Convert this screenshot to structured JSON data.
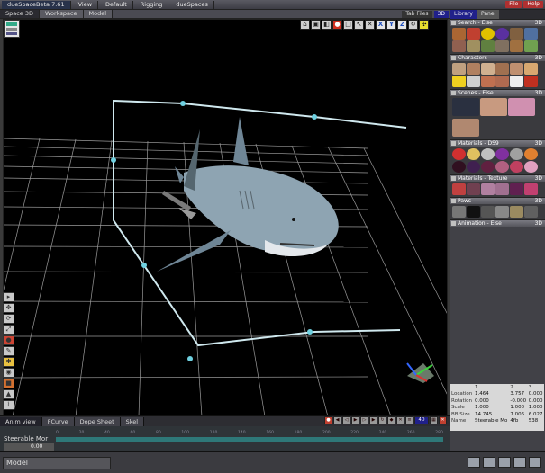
{
  "top_tabs": [
    "dueSpaceBeta 7.61",
    "View",
    "Default",
    "Rigging",
    "dueSpaces"
  ],
  "top_buttons": [
    "File",
    "Help"
  ],
  "sub_tabs": [
    "Space 3D",
    "Workspace",
    "Model"
  ],
  "view_labels": {
    "tab_files": "Tab Files",
    "view3d": "3D"
  },
  "toolbar": {
    "icons": [
      "house",
      "cube",
      "cube2",
      "sphere",
      "box",
      "arrow",
      "cross",
      "X",
      "Y",
      "Z",
      "rotate",
      "grid"
    ],
    "x": "X",
    "y": "Y",
    "z": "Z"
  },
  "right_panel": {
    "tabs": [
      "Library",
      "Panel"
    ],
    "sections": [
      {
        "title": "Search - Eise",
        "d": "3D"
      },
      {
        "title": "Characters",
        "d": "3D"
      },
      {
        "title": "Scenes - Eise",
        "d": "3D"
      },
      {
        "title": "Materials - DS9",
        "d": "3D"
      },
      {
        "title": "Materials - Texture",
        "d": "3D"
      },
      {
        "title": "Paws",
        "d": "3D"
      },
      {
        "title": "Animation - Eise",
        "d": "3D"
      }
    ]
  },
  "params": {
    "header": [
      "",
      "1",
      "2",
      "3"
    ],
    "rows": [
      [
        "Location",
        "1.464",
        "3.757",
        "0.000"
      ],
      [
        "Rotation",
        "0.000",
        "-0.000",
        "0.000"
      ],
      [
        "Scale",
        "1.000",
        "1.000",
        "1.000"
      ],
      [
        "BB Size",
        "14.745",
        "7.006",
        "6.027"
      ],
      [
        "Name",
        "Steerable Mo",
        "4fb",
        "538"
      ]
    ]
  },
  "anim_tabs": [
    "Anim view",
    "FCurve",
    "Dope Sheet",
    "Skel"
  ],
  "anim_buttons": {
    "view_label": "4D"
  },
  "timeline": {
    "label": "Steerable Mor",
    "frame": "0.00",
    "ticks": [
      "0",
      "20",
      "40",
      "60",
      "80",
      "100",
      "120",
      "140",
      "160",
      "180",
      "200",
      "220",
      "240",
      "260",
      "280"
    ]
  },
  "status": {
    "mode": "Model"
  }
}
